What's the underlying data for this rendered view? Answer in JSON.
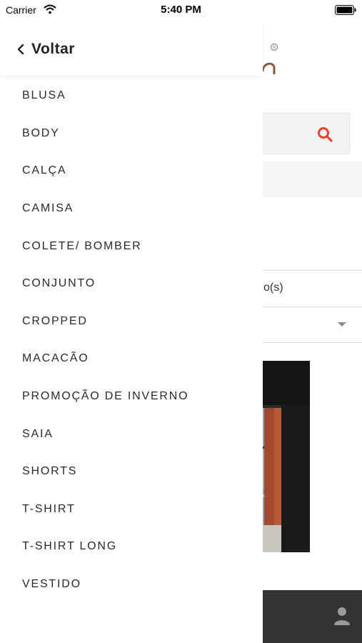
{
  "status_bar": {
    "carrier": "Carrier",
    "time": "5:40 PM"
  },
  "drawer": {
    "back_label": "Voltar",
    "categories": [
      "BLUSA",
      "BODY",
      "CALÇA",
      "CAMISA",
      "COLETE/ BOMBER",
      "CONJUNTO",
      "CROPPED",
      "MACACÃO",
      "PROMOÇÃO DE INVERNO",
      "SAIA",
      "SHORTS",
      "T-SHIRT",
      "T-SHIRT LONG",
      "VESTIDO"
    ]
  },
  "background": {
    "results_text_partial": "o(s)",
    "accent_color": "#e8432f",
    "logo_color": "#8a5a3c",
    "bottom_bar_color": "#333333"
  }
}
